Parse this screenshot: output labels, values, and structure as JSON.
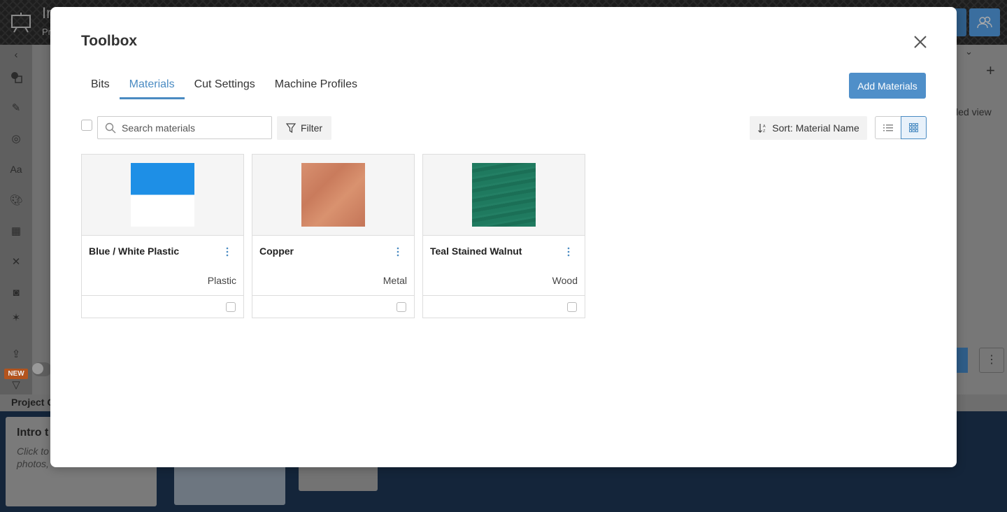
{
  "app": {
    "title": "In",
    "subtitle": "Pr",
    "detailed_view": "iled view",
    "new_badge": "NEW",
    "project_label": "Project C",
    "intro_title": "Intro t",
    "intro_sub_1": "Click to",
    "intro_sub_2": "photos,"
  },
  "modal": {
    "title": "Toolbox",
    "tabs": [
      {
        "label": "Bits",
        "active": false
      },
      {
        "label": "Materials",
        "active": true
      },
      {
        "label": "Cut Settings",
        "active": false
      },
      {
        "label": "Machine Profiles",
        "active": false
      }
    ],
    "add_button": "Add Materials",
    "search": {
      "placeholder": "Search materials",
      "value": ""
    },
    "filter_label": "Filter",
    "sort_label": "Sort: Material Name",
    "view_mode": "grid"
  },
  "materials": [
    {
      "name": "Blue / White Plastic",
      "type": "Plastic",
      "swatch": "blue-white",
      "colors": [
        "#1e8fe6",
        "#ffffff"
      ]
    },
    {
      "name": "Copper",
      "type": "Metal",
      "swatch": "copper",
      "colors": [
        "#d08a68"
      ]
    },
    {
      "name": "Teal Stained Walnut",
      "type": "Wood",
      "swatch": "teal",
      "colors": [
        "#1f7a5f"
      ]
    }
  ],
  "colors": {
    "accent": "#4a8bc2",
    "button": "#4f8fc9"
  }
}
